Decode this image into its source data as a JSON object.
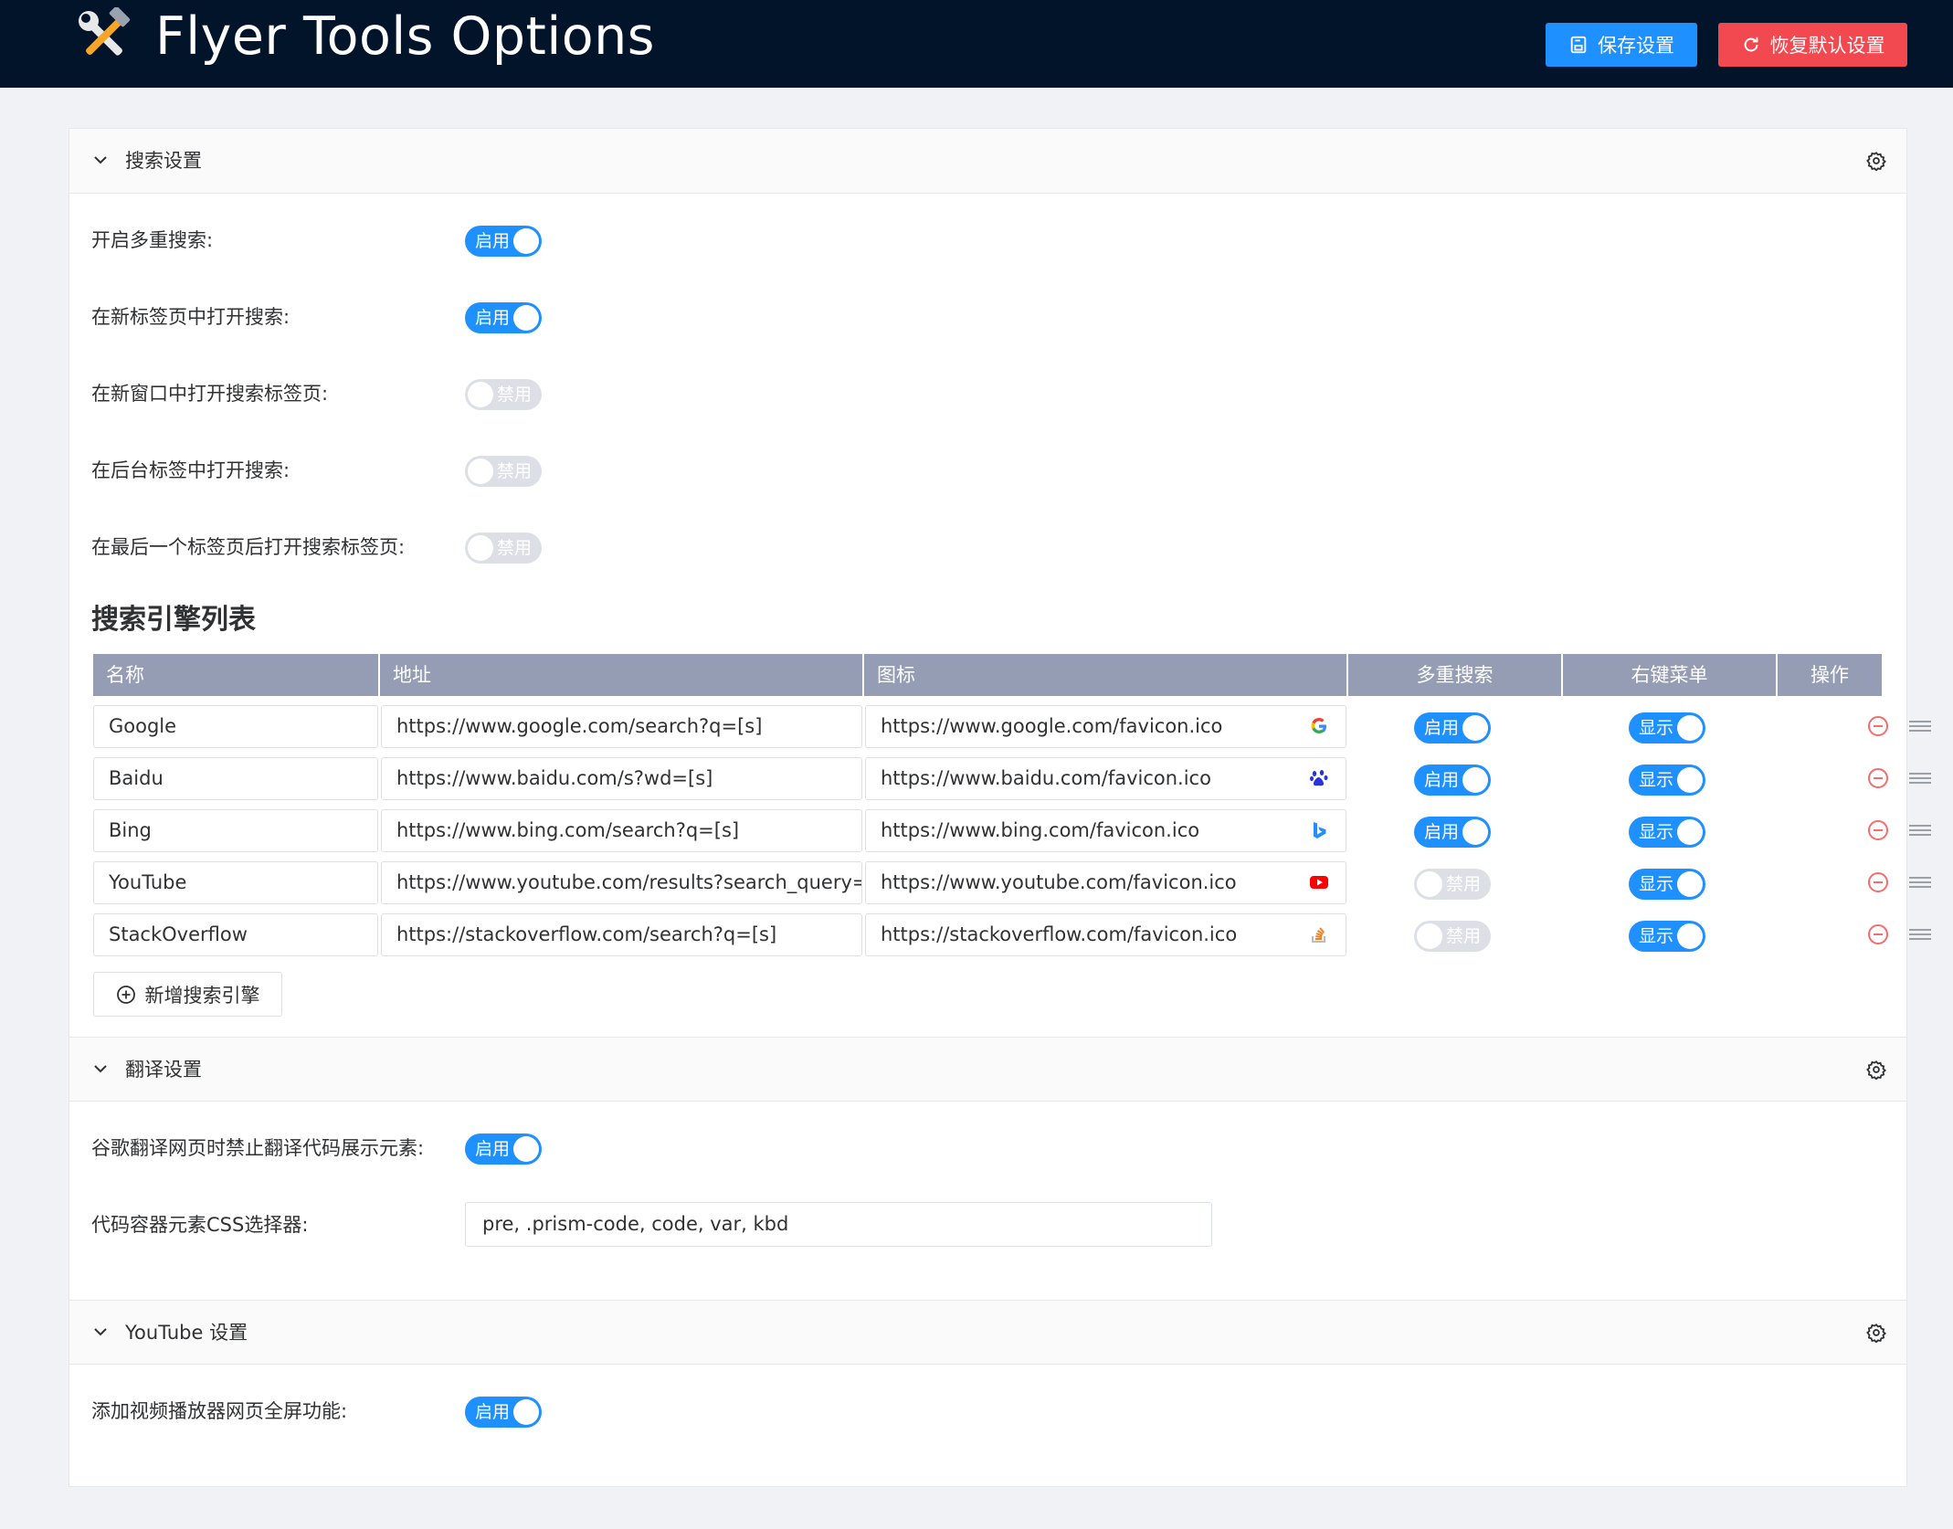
{
  "header": {
    "app_title": "Flyer Tools Options",
    "save_label": "保存设置",
    "reset_label": "恢复默认设置"
  },
  "colors": {
    "header_bg": "#01142a",
    "save_button": "#1e90ff",
    "reset_button": "#f2484f",
    "toggle_on": "#1e90ff",
    "toggle_off": "#dcdfe6",
    "table_header": "#949db3",
    "remove_icon": "#f56c6c"
  },
  "search_section": {
    "title": "搜索设置",
    "settings": [
      {
        "label": "开启多重搜索:",
        "state": "启用",
        "on": true
      },
      {
        "label": "在新标签页中打开搜索:",
        "state": "启用",
        "on": true
      },
      {
        "label": "在新窗口中打开搜索标签页:",
        "state": "禁用",
        "on": false
      },
      {
        "label": "在后台标签中打开搜索:",
        "state": "禁用",
        "on": false
      },
      {
        "label": "在最后一个标签页后打开搜索标签页:",
        "state": "禁用",
        "on": false
      }
    ],
    "list_title": "搜索引擎列表",
    "columns": [
      "名称",
      "地址",
      "图标",
      "多重搜索",
      "右键菜单",
      "操作"
    ],
    "engines": [
      {
        "name": "Google",
        "url": "https://www.google.com/search?q=[s]",
        "icon_url": "https://www.google.com/favicon.ico",
        "icon": "google-icon",
        "multi": "启用",
        "multi_on": true,
        "menu": "显示"
      },
      {
        "name": "Baidu",
        "url": "https://www.baidu.com/s?wd=[s]",
        "icon_url": "https://www.baidu.com/favicon.ico",
        "icon": "baidu-icon",
        "multi": "启用",
        "multi_on": true,
        "menu": "显示"
      },
      {
        "name": "Bing",
        "url": "https://www.bing.com/search?q=[s]",
        "icon_url": "https://www.bing.com/favicon.ico",
        "icon": "bing-icon",
        "multi": "启用",
        "multi_on": true,
        "menu": "显示"
      },
      {
        "name": "YouTube",
        "url": "https://www.youtube.com/results?search_query=[",
        "icon_url": "https://www.youtube.com/favicon.ico",
        "icon": "youtube-icon",
        "multi": "禁用",
        "multi_on": false,
        "menu": "显示"
      },
      {
        "name": "StackOverflow",
        "url": "https://stackoverflow.com/search?q=[s]",
        "icon_url": "https://stackoverflow.com/favicon.ico",
        "icon": "stackoverflow-icon",
        "multi": "禁用",
        "multi_on": false,
        "menu": "显示"
      }
    ],
    "add_label": "新增搜索引擎"
  },
  "translate_section": {
    "title": "翻译设置",
    "disable_label": "谷歌翻译网页时禁止翻译代码展示元素:",
    "disable_state": "启用",
    "selector_label": "代码容器元素CSS选择器:",
    "selector_value": "pre, .prism-code, code, var, kbd"
  },
  "youtube_section": {
    "title": "YouTube 设置",
    "fullscreen_label": "添加视频播放器网页全屏功能:",
    "fullscreen_state": "启用"
  }
}
